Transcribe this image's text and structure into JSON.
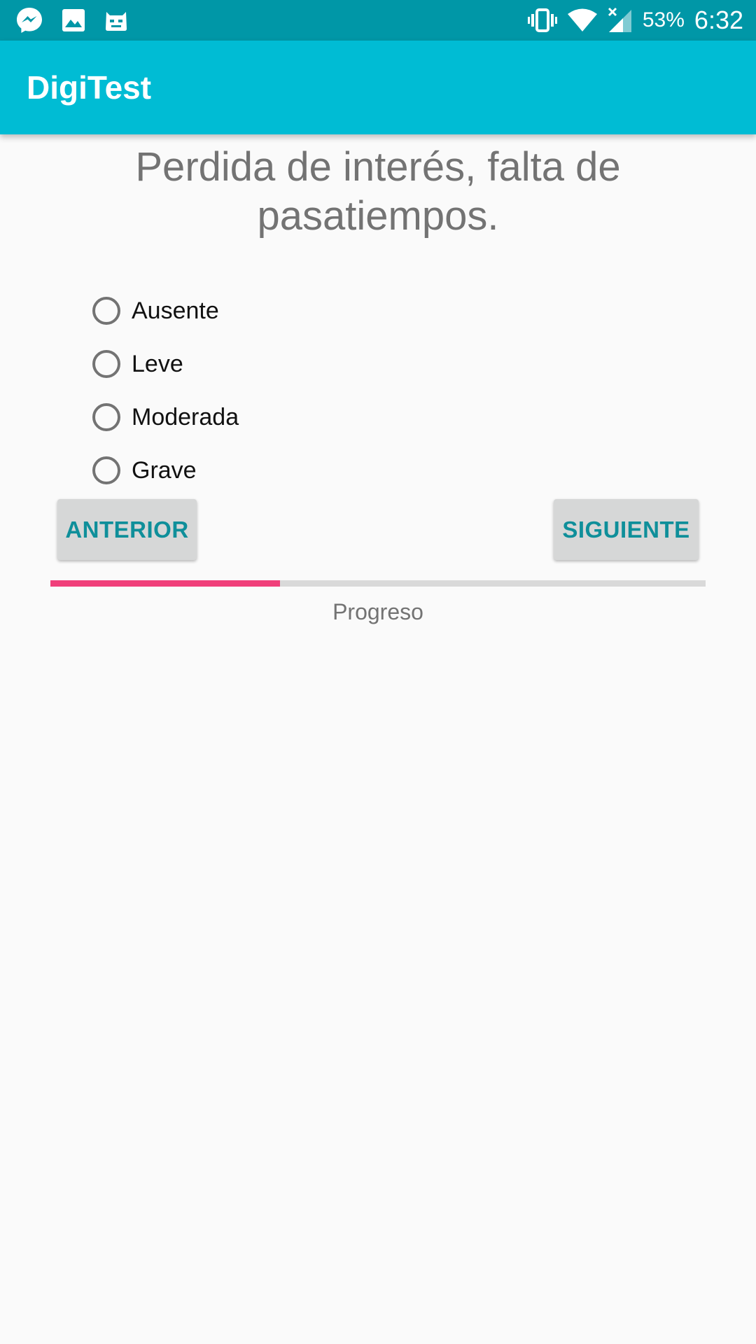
{
  "status_bar": {
    "left_icons": [
      "messenger-icon",
      "gallery-icon",
      "cyanogen-icon"
    ],
    "right_icons": [
      "vibrate-icon",
      "wifi-icon",
      "signal-icon"
    ],
    "battery": "53%",
    "time": "6:32"
  },
  "app_bar": {
    "title": "DigiTest"
  },
  "question": {
    "text": "Perdida de interés, falta de pasatiempos."
  },
  "options": [
    {
      "label": "Ausente",
      "selected": false
    },
    {
      "label": "Leve",
      "selected": false
    },
    {
      "label": "Moderada",
      "selected": false
    },
    {
      "label": "Grave",
      "selected": false
    }
  ],
  "buttons": {
    "previous": "ANTERIOR",
    "next": "SIGUIENTE"
  },
  "progress": {
    "label": "Progreso",
    "fraction": 0.35
  },
  "colors": {
    "status_bar": "#0097a7",
    "app_bar": "#00bcd4",
    "accent": "#f03f7a",
    "button_text": "#0f8f9a",
    "background": "#fafafa"
  }
}
